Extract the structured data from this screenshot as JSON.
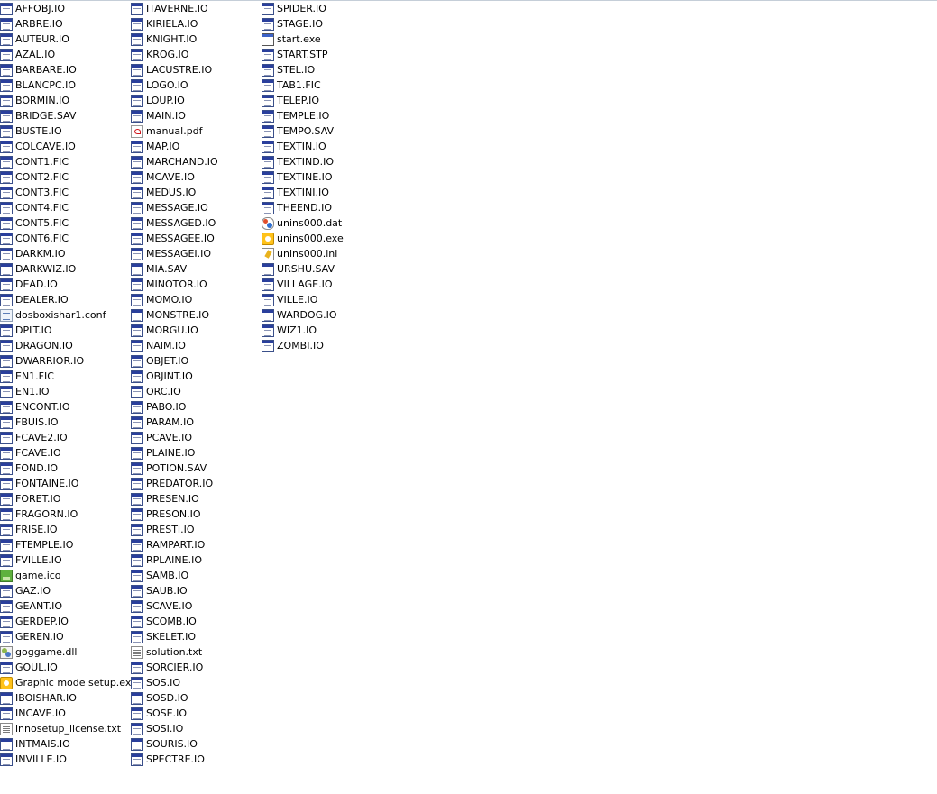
{
  "columns": [
    {
      "items": [
        {
          "name": "AFFOBJ.IO",
          "icon": "io-file-icon"
        },
        {
          "name": "ARBRE.IO",
          "icon": "io-file-icon"
        },
        {
          "name": "AUTEUR.IO",
          "icon": "io-file-icon"
        },
        {
          "name": "AZAL.IO",
          "icon": "io-file-icon"
        },
        {
          "name": "BARBARE.IO",
          "icon": "io-file-icon"
        },
        {
          "name": "BLANCPC.IO",
          "icon": "io-file-icon"
        },
        {
          "name": "BORMIN.IO",
          "icon": "io-file-icon"
        },
        {
          "name": "BRIDGE.SAV",
          "icon": "io-file-icon"
        },
        {
          "name": "BUSTE.IO",
          "icon": "io-file-icon"
        },
        {
          "name": "COLCAVE.IO",
          "icon": "io-file-icon"
        },
        {
          "name": "CONT1.FIC",
          "icon": "io-file-icon"
        },
        {
          "name": "CONT2.FIC",
          "icon": "io-file-icon"
        },
        {
          "name": "CONT3.FIC",
          "icon": "io-file-icon"
        },
        {
          "name": "CONT4.FIC",
          "icon": "io-file-icon"
        },
        {
          "name": "CONT5.FIC",
          "icon": "io-file-icon"
        },
        {
          "name": "CONT6.FIC",
          "icon": "io-file-icon"
        },
        {
          "name": "DARKM.IO",
          "icon": "io-file-icon"
        },
        {
          "name": "DARKWIZ.IO",
          "icon": "io-file-icon"
        },
        {
          "name": "DEAD.IO",
          "icon": "io-file-icon"
        },
        {
          "name": "DEALER.IO",
          "icon": "io-file-icon"
        },
        {
          "name": "dosboxishar1.conf",
          "icon": "config-file-icon"
        },
        {
          "name": "DPLT.IO",
          "icon": "io-file-icon"
        },
        {
          "name": "DRAGON.IO",
          "icon": "io-file-icon"
        },
        {
          "name": "DWARRIOR.IO",
          "icon": "io-file-icon"
        },
        {
          "name": "EN1.FIC",
          "icon": "io-file-icon"
        },
        {
          "name": "EN1.IO",
          "icon": "io-file-icon"
        },
        {
          "name": "ENCONT.IO",
          "icon": "io-file-icon"
        },
        {
          "name": "FBUIS.IO",
          "icon": "io-file-icon"
        },
        {
          "name": "FCAVE2.IO",
          "icon": "io-file-icon"
        },
        {
          "name": "FCAVE.IO",
          "icon": "io-file-icon"
        },
        {
          "name": "FOND.IO",
          "icon": "io-file-icon"
        },
        {
          "name": "FONTAINE.IO",
          "icon": "io-file-icon"
        },
        {
          "name": "FORET.IO",
          "icon": "io-file-icon"
        },
        {
          "name": "FRAGORN.IO",
          "icon": "io-file-icon"
        },
        {
          "name": "FRISE.IO",
          "icon": "io-file-icon"
        },
        {
          "name": "FTEMPLE.IO",
          "icon": "io-file-icon"
        },
        {
          "name": "FVILLE.IO",
          "icon": "io-file-icon"
        },
        {
          "name": "game.ico",
          "icon": "ico-file-icon"
        },
        {
          "name": "GAZ.IO",
          "icon": "io-file-icon"
        },
        {
          "name": "GEANT.IO",
          "icon": "io-file-icon"
        },
        {
          "name": "GERDEP.IO",
          "icon": "io-file-icon"
        },
        {
          "name": "GEREN.IO",
          "icon": "io-file-icon"
        },
        {
          "name": "goggame.dll",
          "icon": "dll-file-icon"
        },
        {
          "name": "GOUL.IO",
          "icon": "io-file-icon"
        },
        {
          "name": "Graphic mode setup.exe",
          "icon": "setup-exe-icon"
        },
        {
          "name": "IBOISHAR.IO",
          "icon": "io-file-icon"
        },
        {
          "name": "INCAVE.IO",
          "icon": "io-file-icon"
        },
        {
          "name": "innosetup_license.txt",
          "icon": "text-file-icon"
        },
        {
          "name": "INTMAIS.IO",
          "icon": "io-file-icon"
        },
        {
          "name": "INVILLE.IO",
          "icon": "io-file-icon"
        }
      ]
    },
    {
      "items": [
        {
          "name": "ITAVERNE.IO",
          "icon": "io-file-icon"
        },
        {
          "name": "KIRIELA.IO",
          "icon": "io-file-icon"
        },
        {
          "name": "KNIGHT.IO",
          "icon": "io-file-icon"
        },
        {
          "name": "KROG.IO",
          "icon": "io-file-icon"
        },
        {
          "name": "LACUSTRE.IO",
          "icon": "io-file-icon"
        },
        {
          "name": "LOGO.IO",
          "icon": "io-file-icon"
        },
        {
          "name": "LOUP.IO",
          "icon": "io-file-icon"
        },
        {
          "name": "MAIN.IO",
          "icon": "io-file-icon"
        },
        {
          "name": "manual.pdf",
          "icon": "pdf-file-icon"
        },
        {
          "name": "MAP.IO",
          "icon": "io-file-icon"
        },
        {
          "name": "MARCHAND.IO",
          "icon": "io-file-icon"
        },
        {
          "name": "MCAVE.IO",
          "icon": "io-file-icon"
        },
        {
          "name": "MEDUS.IO",
          "icon": "io-file-icon"
        },
        {
          "name": "MESSAGE.IO",
          "icon": "io-file-icon"
        },
        {
          "name": "MESSAGED.IO",
          "icon": "io-file-icon"
        },
        {
          "name": "MESSAGEE.IO",
          "icon": "io-file-icon"
        },
        {
          "name": "MESSAGEI.IO",
          "icon": "io-file-icon"
        },
        {
          "name": "MIA.SAV",
          "icon": "io-file-icon"
        },
        {
          "name": "MINOTOR.IO",
          "icon": "io-file-icon"
        },
        {
          "name": "MOMO.IO",
          "icon": "io-file-icon"
        },
        {
          "name": "MONSTRE.IO",
          "icon": "io-file-icon"
        },
        {
          "name": "MORGU.IO",
          "icon": "io-file-icon"
        },
        {
          "name": "NAIM.IO",
          "icon": "io-file-icon"
        },
        {
          "name": "OBJET.IO",
          "icon": "io-file-icon"
        },
        {
          "name": "OBJINT.IO",
          "icon": "io-file-icon"
        },
        {
          "name": "ORC.IO",
          "icon": "io-file-icon"
        },
        {
          "name": "PABO.IO",
          "icon": "io-file-icon"
        },
        {
          "name": "PARAM.IO",
          "icon": "io-file-icon"
        },
        {
          "name": "PCAVE.IO",
          "icon": "io-file-icon"
        },
        {
          "name": "PLAINE.IO",
          "icon": "io-file-icon"
        },
        {
          "name": "POTION.SAV",
          "icon": "io-file-icon"
        },
        {
          "name": "PREDATOR.IO",
          "icon": "io-file-icon"
        },
        {
          "name": "PRESEN.IO",
          "icon": "io-file-icon"
        },
        {
          "name": "PRESON.IO",
          "icon": "io-file-icon"
        },
        {
          "name": "PRESTI.IO",
          "icon": "io-file-icon"
        },
        {
          "name": "RAMPART.IO",
          "icon": "io-file-icon"
        },
        {
          "name": "RPLAINE.IO",
          "icon": "io-file-icon"
        },
        {
          "name": "SAMB.IO",
          "icon": "io-file-icon"
        },
        {
          "name": "SAUB.IO",
          "icon": "io-file-icon"
        },
        {
          "name": "SCAVE.IO",
          "icon": "io-file-icon"
        },
        {
          "name": "SCOMB.IO",
          "icon": "io-file-icon"
        },
        {
          "name": "SKELET.IO",
          "icon": "io-file-icon"
        },
        {
          "name": "solution.txt",
          "icon": "text-file-icon"
        },
        {
          "name": "SORCIER.IO",
          "icon": "io-file-icon"
        },
        {
          "name": "SOS.IO",
          "icon": "io-file-icon"
        },
        {
          "name": "SOSD.IO",
          "icon": "io-file-icon"
        },
        {
          "name": "SOSE.IO",
          "icon": "io-file-icon"
        },
        {
          "name": "SOSI.IO",
          "icon": "io-file-icon"
        },
        {
          "name": "SOURIS.IO",
          "icon": "io-file-icon"
        },
        {
          "name": "SPECTRE.IO",
          "icon": "io-file-icon"
        }
      ]
    },
    {
      "items": [
        {
          "name": "SPIDER.IO",
          "icon": "io-file-icon"
        },
        {
          "name": "STAGE.IO",
          "icon": "io-file-icon"
        },
        {
          "name": "start.exe",
          "icon": "exe-file-icon"
        },
        {
          "name": "START.STP",
          "icon": "io-file-icon"
        },
        {
          "name": "STEL.IO",
          "icon": "io-file-icon"
        },
        {
          "name": "TAB1.FIC",
          "icon": "io-file-icon"
        },
        {
          "name": "TELEP.IO",
          "icon": "io-file-icon"
        },
        {
          "name": "TEMPLE.IO",
          "icon": "io-file-icon"
        },
        {
          "name": "TEMPO.SAV",
          "icon": "io-file-icon"
        },
        {
          "name": "TEXTIN.IO",
          "icon": "io-file-icon"
        },
        {
          "name": "TEXTIND.IO",
          "icon": "io-file-icon"
        },
        {
          "name": "TEXTINE.IO",
          "icon": "io-file-icon"
        },
        {
          "name": "TEXTINI.IO",
          "icon": "io-file-icon"
        },
        {
          "name": "THEEND.IO",
          "icon": "io-file-icon"
        },
        {
          "name": "unins000.dat",
          "icon": "dat-file-icon"
        },
        {
          "name": "unins000.exe",
          "icon": "setup-exe-icon"
        },
        {
          "name": "unins000.ini",
          "icon": "ini-file-icon"
        },
        {
          "name": "URSHU.SAV",
          "icon": "io-file-icon"
        },
        {
          "name": "VILLAGE.IO",
          "icon": "io-file-icon"
        },
        {
          "name": "VILLE.IO",
          "icon": "io-file-icon"
        },
        {
          "name": "WARDOG.IO",
          "icon": "io-file-icon"
        },
        {
          "name": "WIZ1.IO",
          "icon": "io-file-icon"
        },
        {
          "name": "ZOMBI.IO",
          "icon": "io-file-icon"
        }
      ]
    }
  ]
}
